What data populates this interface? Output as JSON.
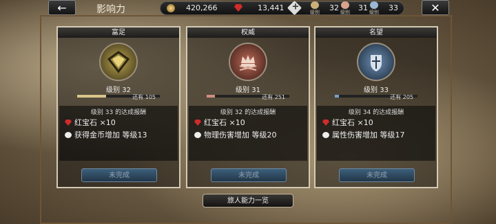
{
  "header": {
    "back_icon": "←",
    "title": "影响力",
    "gold": "420,266",
    "ruby": "13,441",
    "plus_icon": "+",
    "ranks": [
      {
        "label": "级别",
        "value": "32",
        "color": "#c9b07a"
      },
      {
        "label": "级别",
        "value": "31",
        "color": "#d8a38e"
      },
      {
        "label": "级别",
        "value": "33",
        "color": "#9bb7d2"
      }
    ],
    "close_icon": "✕"
  },
  "panels": [
    {
      "name": "富足",
      "emblem_color": "#8a7a3a",
      "level": "级别  32",
      "remaining": "还有 105",
      "xp_fraction": 0.35,
      "xp_color": "#d9c68a",
      "reward_title": "级别  33 的达成报酬",
      "rewards": [
        {
          "icon": "ruby",
          "text": "红宝石 ×10"
        },
        {
          "icon": "white",
          "text": "获得金币增加  等级13"
        }
      ],
      "status": "未完成"
    },
    {
      "name": "权威",
      "emblem_color": "#8a4a3a",
      "level": "级别  31",
      "remaining": "还有 251",
      "xp_fraction": 0.1,
      "xp_color": "#cf8f7f",
      "reward_title": "级别  32 的达成报酬",
      "rewards": [
        {
          "icon": "ruby",
          "text": "红宝石 ×10"
        },
        {
          "icon": "white",
          "text": "物理伤害增加  等级20"
        }
      ],
      "status": "未完成"
    },
    {
      "name": "名望",
      "emblem_color": "#3a4f6a",
      "level": "级别  33",
      "remaining": "还有 205",
      "xp_fraction": 0.05,
      "xp_color": "#7aa0d0",
      "reward_title": "级别  34 的达成报酬",
      "rewards": [
        {
          "icon": "ruby",
          "text": "红宝石 ×10"
        },
        {
          "icon": "white",
          "text": "属性伤害增加  等级17"
        }
      ],
      "status": "未完成"
    }
  ],
  "footer": {
    "abilities_button": "旅人能力一览"
  }
}
